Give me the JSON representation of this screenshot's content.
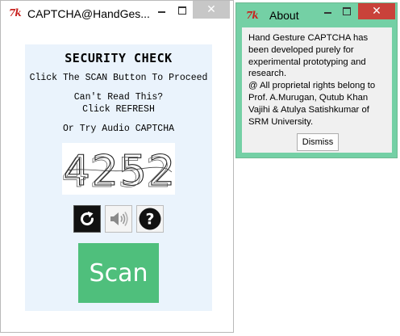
{
  "main_window": {
    "app_icon": "tk-feather-icon",
    "title": "CAPTCHA@HandGes...",
    "controls": {
      "minimize": "minimize-icon",
      "maximize": "maximize-icon",
      "close_label": "✕"
    },
    "panel": {
      "heading": "SECURITY CHECK",
      "instruction": "Click The SCAN Button To Proceed",
      "cant_read_line1": "Can't Read This?",
      "cant_read_line2": "Click REFRESH",
      "audio_hint": "Or Try Audio CAPTCHA",
      "captcha_code": "4252",
      "refresh_icon": "refresh-icon",
      "audio_icon": "speaker-icon",
      "help_icon": "question-icon",
      "scan_label": "Scan"
    }
  },
  "about_window": {
    "app_icon": "tk-feather-icon",
    "title": "About",
    "controls": {
      "minimize": "minimize-icon",
      "maximize": "maximize-icon",
      "close_label": "✕"
    },
    "lines": [
      "Hand Gesture CAPTCHA has",
      "been developed purely for",
      "experimental prototyping and",
      "research.",
      "@ All proprietal rights belong to",
      "Prof. A.Murugan, Qutub Khan",
      "Vajihi & Atulya Satishkumar of",
      "SRM University."
    ],
    "dismiss_label": "Dismiss"
  },
  "colors": {
    "scan_button": "#4fbf7c",
    "about_frame": "#74d0a5",
    "about_close": "#c9423a",
    "panel_background": "#eaf3fc"
  }
}
